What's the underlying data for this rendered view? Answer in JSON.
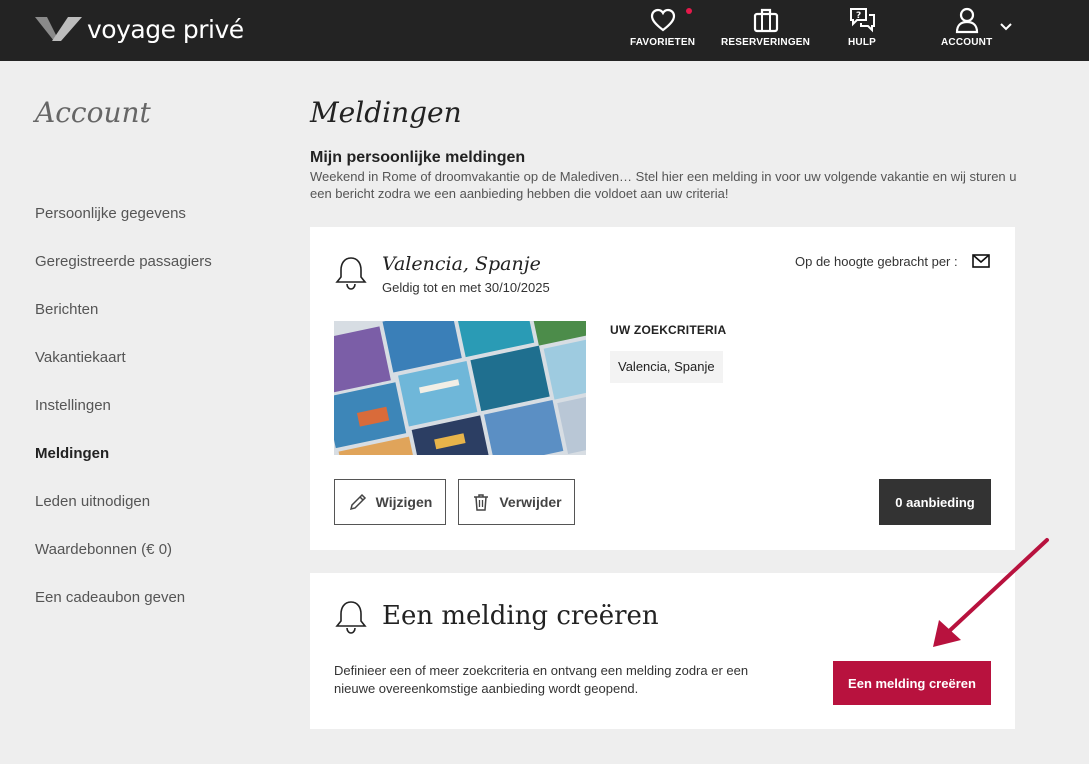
{
  "header": {
    "logo_text": "voyage privé",
    "nav": {
      "favorites": "FAVORIETEN",
      "reservations": "RESERVERINGEN",
      "help": "HULP",
      "account": "ACCOUNT"
    },
    "favorites_dot_color": "#e6194b"
  },
  "sidebar": {
    "title": "Account",
    "items": [
      {
        "label": "Persoonlijke gegevens"
      },
      {
        "label": "Geregistreerde passagiers"
      },
      {
        "label": "Berichten"
      },
      {
        "label": "Vakantiekaart"
      },
      {
        "label": "Instellingen"
      },
      {
        "label": "Meldingen",
        "active": true
      },
      {
        "label": "Leden uitnodigen"
      },
      {
        "label": "Waardebonnen (€ 0)"
      },
      {
        "label": "Een cadeaubon geven"
      }
    ]
  },
  "main": {
    "title": "Meldingen",
    "subtitle": "Mijn persoonlijke meldingen",
    "description": "Weekend in Rome of droomvakantie op de Malediven… Stel hier een melding in voor uw volgende vakantie en wij sturen u een bericht zodra we een aanbieding hebben die voldoet aan uw criteria!",
    "alert": {
      "title": "Valencia, Spanje",
      "valid": "Geldig tot en met 30/10/2025",
      "notify_label": "Op de hoogte gebracht per :",
      "criteria_label": "UW ZOEKCRITERIA",
      "criteria_value": "Valencia, Spanje",
      "edit_label": "Wijzigen",
      "delete_label": "Verwijder",
      "offers_label": "0 aanbieding"
    },
    "create": {
      "title": "Een melding creëren",
      "description": "Definieer een of meer zoekcriteria en ontvang een melding zodra er een nieuwe overeenkomstige aanbieding wordt geopend.",
      "button_label": "Een melding creëren"
    }
  },
  "colors": {
    "header_bg": "#232323",
    "accent": "#b8123e",
    "annotation_arrow": "#b8123e",
    "page_bg": "#eeeeee"
  },
  "icons": [
    "logo-mark-icon",
    "heart-icon",
    "suitcase-icon",
    "chat-help-icon",
    "user-icon",
    "chevron-down-icon",
    "bell-icon",
    "mail-icon",
    "pencil-icon",
    "trash-icon",
    "arrow-annotation"
  ]
}
